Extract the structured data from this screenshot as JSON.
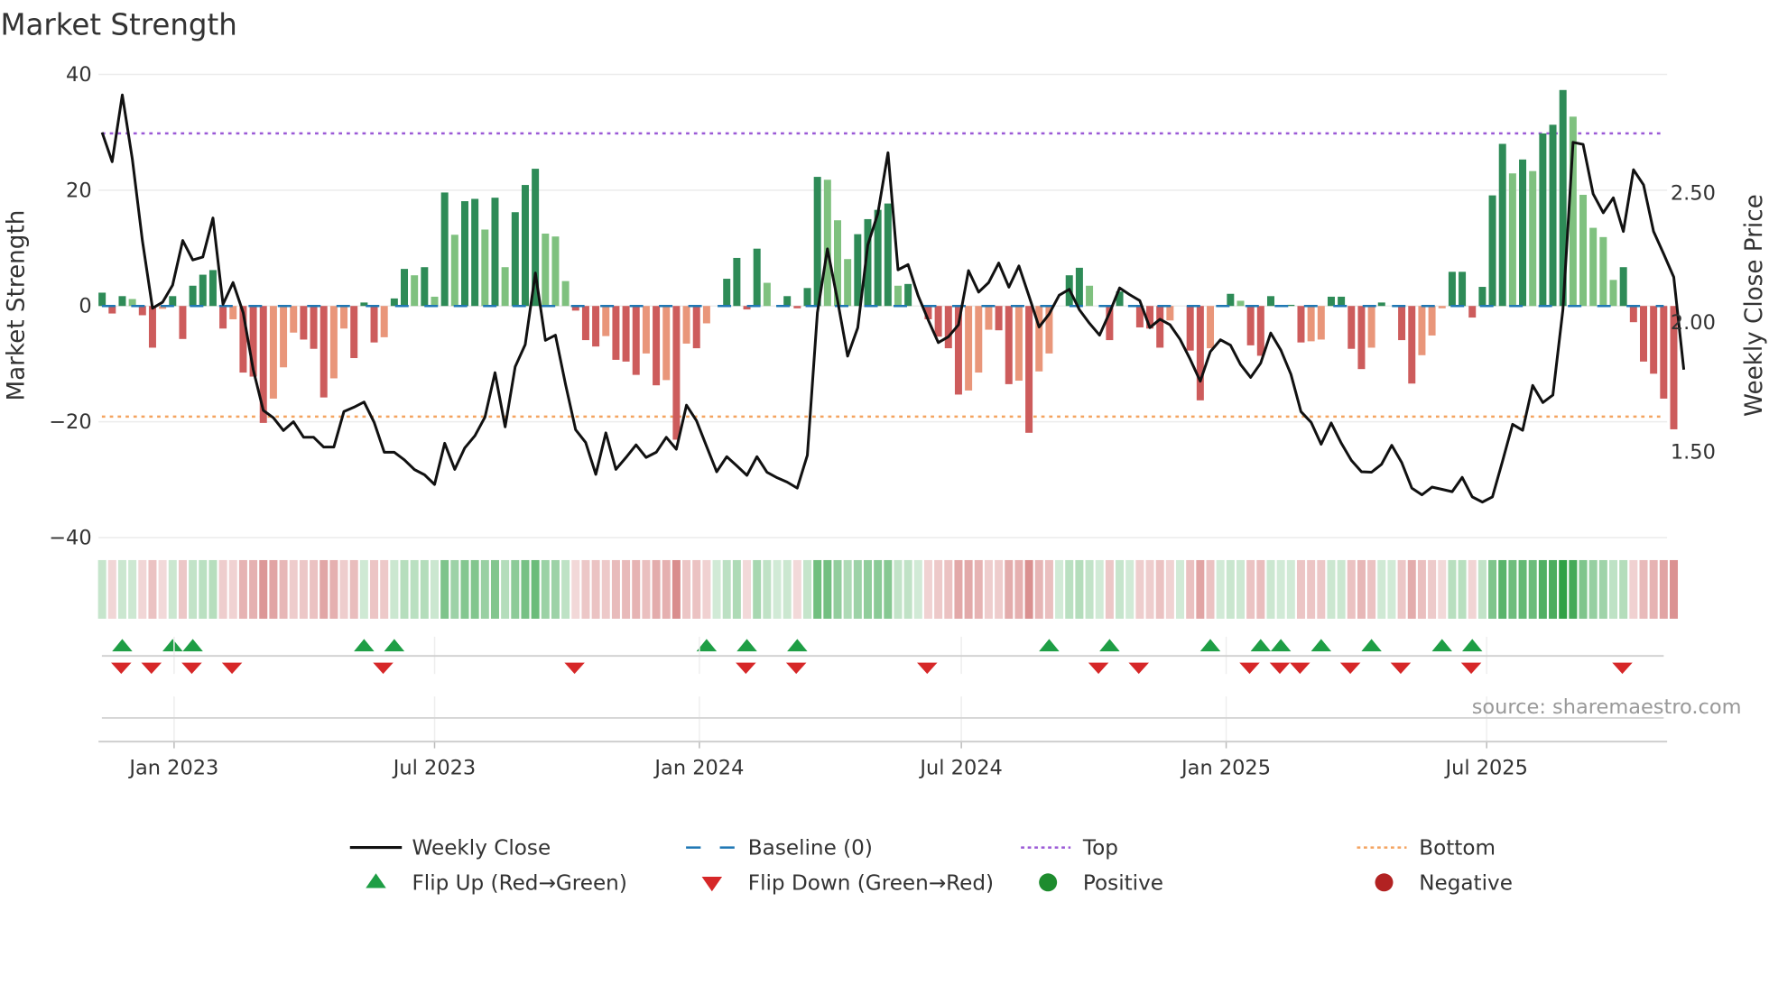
{
  "title": "Market Strength",
  "source": "source: sharemaestro.com",
  "chart_data": {
    "type": "bar",
    "title": "Market Strength",
    "ylabel": "Market Strength",
    "y2label": "Weekly Close Price",
    "ylim": [
      -40,
      40
    ],
    "y2lim": [
      1.17,
      2.957
    ],
    "yticks": [
      40,
      20,
      0,
      -20,
      -40
    ],
    "ytick_labels": [
      "40",
      "20",
      "0",
      "−20",
      "−40"
    ],
    "y2ticks": [
      2.5,
      2.0,
      1.5
    ],
    "y2tick_labels": [
      "2.50",
      "2.00",
      "1.50"
    ],
    "x_start_date": "2022-11-12",
    "x_step_days": 7,
    "xticks": [
      {
        "date": "2023-01-01",
        "label": "Jan 2023"
      },
      {
        "date": "2023-07-01",
        "label": "Jul 2023"
      },
      {
        "date": "2024-01-01",
        "label": "Jan 2024"
      },
      {
        "date": "2024-07-01",
        "label": "Jul 2024"
      },
      {
        "date": "2025-01-01",
        "label": "Jan 2025"
      },
      {
        "date": "2025-07-01",
        "label": "Jul 2025"
      }
    ],
    "reference_lines": {
      "top": 29.8,
      "bottom": -19.1,
      "baseline": 0
    },
    "strength": [
      2.3,
      -1.3,
      1.7,
      1.2,
      -1.6,
      -7.2,
      -0.5,
      1.7,
      -5.7,
      3.5,
      5.4,
      6.2,
      -3.9,
      -2.3,
      -11.5,
      -12.2,
      -20.2,
      -16,
      -10.6,
      -4.6,
      -5.8,
      -7.4,
      -15.8,
      -12.5,
      -3.9,
      -9,
      0.6,
      -6.3,
      -5.4,
      1.3,
      6.4,
      5.3,
      6.7,
      1.6,
      19.6,
      12.3,
      18.1,
      18.5,
      13.2,
      18.7,
      6.7,
      16.2,
      20.9,
      23.7,
      12.5,
      12,
      4.3,
      -0.8,
      -5.9,
      -7,
      -5.2,
      -9.3,
      -9.6,
      -11.9,
      -8.2,
      -13.7,
      -12.8,
      -23.1,
      -6.5,
      -7.3,
      -3,
      0,
      4.7,
      8.3,
      -0.6,
      9.9,
      4,
      0,
      1.7,
      -0.4,
      3.1,
      22.3,
      21.8,
      14.8,
      8.1,
      12.4,
      15,
      16.6,
      17.7,
      3.5,
      3.8,
      0,
      -2.3,
      -5.3,
      -7.3,
      -15.3,
      -14.6,
      -11.5,
      -4.1,
      -4.2,
      -13.5,
      -12.9,
      -21.9,
      -11.3,
      -8.2,
      0,
      5.3,
      6.6,
      3.5,
      0,
      -5.9,
      2.5,
      0,
      -3.7,
      -3.9,
      -7.2,
      -2.5,
      0,
      -7.7,
      -16.3,
      -7.3,
      0,
      2.1,
      0.9,
      -6.8,
      -8.6,
      1.7,
      0,
      0.2,
      -6.3,
      -6.1,
      -5.8,
      1.6,
      1.6,
      -7.4,
      -10.9,
      -7.2,
      0.6,
      0,
      -5.9,
      -13.4,
      -8.5,
      -5.1,
      -0.4,
      5.9,
      5.9,
      -2,
      3.3,
      19.1,
      28,
      22.9,
      25.3,
      23.3,
      29.8,
      31.3,
      37.3,
      32.7,
      19.2,
      13.5,
      11.9,
      4.5,
      6.7,
      -2.8,
      -9.6,
      -11.7,
      -16,
      -21.3
    ],
    "weekly_close": [
      2.733,
      2.62,
      2.878,
      2.63,
      2.316,
      2.055,
      2.078,
      2.144,
      2.316,
      2.241,
      2.252,
      2.403,
      2.07,
      2.154,
      2.038,
      1.818,
      1.661,
      1.632,
      1.583,
      1.617,
      1.557,
      1.557,
      1.519,
      1.519,
      1.656,
      1.673,
      1.693,
      1.615,
      1.499,
      1.499,
      1.47,
      1.432,
      1.412,
      1.375,
      1.534,
      1.433,
      1.516,
      1.563,
      1.635,
      1.806,
      1.597,
      1.829,
      1.915,
      2.191,
      1.931,
      1.951,
      1.76,
      1.586,
      1.537,
      1.414,
      1.574,
      1.433,
      1.479,
      1.528,
      1.479,
      1.499,
      1.557,
      1.511,
      1.681,
      1.621,
      1.522,
      1.424,
      1.482,
      1.447,
      1.41,
      1.482,
      1.422,
      1.401,
      1.384,
      1.361,
      1.488,
      2.038,
      2.284,
      2.084,
      1.87,
      1.98,
      2.299,
      2.42,
      2.655,
      2.203,
      2.223,
      2.102,
      2.009,
      1.922,
      1.945,
      1.991,
      2.2,
      2.117,
      2.154,
      2.229,
      2.136,
      2.218,
      2.102,
      1.982,
      2.032,
      2.105,
      2.128,
      2.049,
      1.997,
      1.951,
      2.038,
      2.133,
      2.107,
      2.084,
      1.98,
      2.012,
      1.991,
      1.935,
      1.858,
      1.773,
      1.887,
      1.933,
      1.912,
      1.838,
      1.788,
      1.843,
      1.959,
      1.893,
      1.8,
      1.656,
      1.615,
      1.53,
      1.612,
      1.534,
      1.468,
      1.424,
      1.422,
      1.453,
      1.526,
      1.459,
      1.361,
      1.335,
      1.365,
      1.356,
      1.347,
      1.402,
      1.327,
      1.307,
      1.327,
      1.464,
      1.607,
      1.584,
      1.757,
      1.691,
      1.72,
      2.049,
      2.695,
      2.687,
      2.496,
      2.423,
      2.481,
      2.351,
      2.589,
      2.531,
      2.351,
      2.264,
      2.175,
      1.818
    ],
    "flip_up_weeks": [
      2,
      7,
      9,
      26,
      29,
      60,
      64,
      69,
      94,
      100,
      110,
      115,
      117,
      121,
      126,
      133,
      136
    ],
    "flip_down_weeks": [
      1,
      4,
      8,
      12,
      27,
      46,
      63,
      68,
      81,
      98,
      102,
      113,
      116,
      118,
      123,
      128,
      135,
      150
    ],
    "legend_placement": "bottom",
    "legend": [
      {
        "key": "weekly_close",
        "label": "Weekly Close"
      },
      {
        "key": "baseline",
        "label": "Baseline (0)"
      },
      {
        "key": "top",
        "label": "Top"
      },
      {
        "key": "bottom",
        "label": "Bottom"
      },
      {
        "key": "flip_up",
        "label": "Flip Up (Red→Green)"
      },
      {
        "key": "flip_down",
        "label": "Flip Down (Green→Red)"
      },
      {
        "key": "positive",
        "label": "Positive"
      },
      {
        "key": "negative",
        "label": "Negative"
      }
    ]
  },
  "colors": {
    "pos_strong": "#2e8b57",
    "pos_weak": "#7fc17f",
    "neg_strong": "#cd5c5c",
    "neg_weak": "#e9967a",
    "line": "#111111",
    "baseline": "#1f77b4",
    "top": "#9b59d6",
    "bottom": "#f4a460",
    "flip_up": "#1e9e45",
    "flip_down": "#d62728",
    "positive": "#1e8c2e",
    "negative": "#b22222",
    "grid": "#ececec"
  }
}
